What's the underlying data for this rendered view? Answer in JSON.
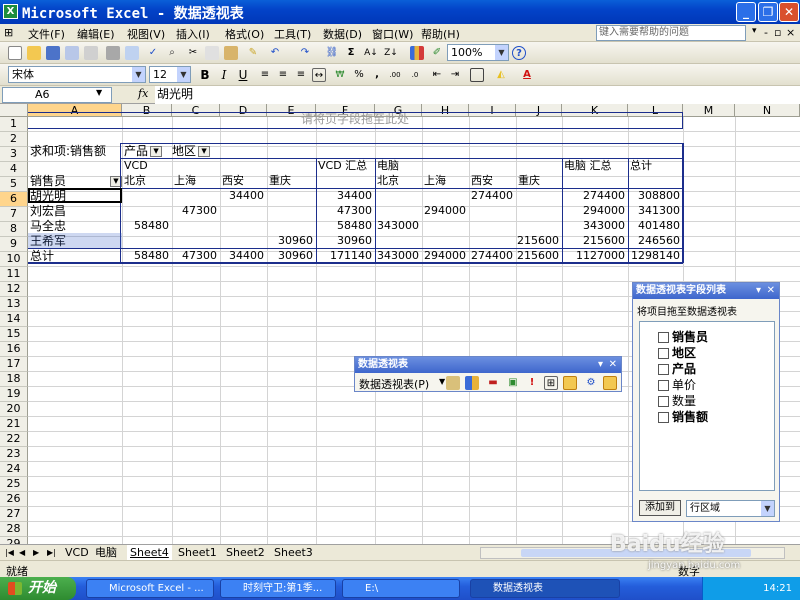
{
  "window": {
    "title": "Microsoft Excel - 数据透视表",
    "app_icon": "X",
    "help_placeholder": "键入需要帮助的问题"
  },
  "menu": [
    "文件(F)",
    "编辑(E)",
    "视图(V)",
    "插入(I)",
    "格式(O)",
    "工具(T)",
    "数据(D)",
    "窗口(W)",
    "帮助(H)"
  ],
  "toolbar": {
    "zoom": "100%",
    "font": "宋体",
    "size": "12",
    "bold": "B",
    "italic": "I",
    "underline": "U"
  },
  "formula": {
    "cell_ref": "A6",
    "fx": "fx",
    "content": "胡光明"
  },
  "columns": [
    "A",
    "B",
    "C",
    "D",
    "E",
    "F",
    "G",
    "H",
    "I",
    "J",
    "K",
    "L",
    "M",
    "N"
  ],
  "rows": [
    "1",
    "2",
    "3",
    "4",
    "5",
    "6",
    "7",
    "8",
    "9",
    "10",
    "11",
    "12",
    "13",
    "14",
    "15",
    "16",
    "17",
    "18",
    "19",
    "20",
    "21",
    "22",
    "23",
    "24",
    "25",
    "26",
    "27",
    "28",
    "29"
  ],
  "pivot": {
    "page_drop": "请将页字段拖至此处",
    "data_label": "求和项:销售额",
    "col_field_1": "产品",
    "col_field_2": "地区",
    "vcd": "VCD",
    "vcd_total": "VCD 汇总",
    "pc": "电脑",
    "pc_total": "电脑 汇总",
    "grand_total": "总计",
    "row_field": "销售员",
    "regions": [
      "北京",
      "上海",
      "西安",
      "重庆",
      "北京",
      "上海",
      "西安",
      "重庆"
    ],
    "rows": [
      {
        "name": "胡光明",
        "cells": [
          "",
          "",
          "34400",
          "",
          "34400",
          "",
          "",
          "274400",
          "",
          "274400",
          "308800"
        ]
      },
      {
        "name": "刘宏昌",
        "cells": [
          "",
          "47300",
          "",
          "",
          "47300",
          "",
          "294000",
          "",
          "",
          "294000",
          "341300"
        ]
      },
      {
        "name": "马全忠",
        "cells": [
          "58480",
          "",
          "",
          "",
          "58480",
          "343000",
          "",
          "",
          "",
          "343000",
          "401480"
        ]
      },
      {
        "name": "王希军",
        "cells": [
          "",
          "",
          "",
          "30960",
          "30960",
          "",
          "",
          "",
          "215600",
          "215600",
          "246560"
        ]
      },
      {
        "name": "总计",
        "cells": [
          "58480",
          "47300",
          "34400",
          "30960",
          "171140",
          "343000",
          "294000",
          "274400",
          "215600",
          "1127000",
          "1298140"
        ]
      }
    ]
  },
  "pivot_toolbar": {
    "title": "数据透视表",
    "menu": "数据透视表(P)"
  },
  "field_list": {
    "title": "数据透视表字段列表",
    "hint": "将项目拖至数据透视表",
    "fields": [
      {
        "label": "销售员",
        "bold": true
      },
      {
        "label": "地区",
        "bold": true
      },
      {
        "label": "产品",
        "bold": true
      },
      {
        "label": "单价",
        "bold": false
      },
      {
        "label": "数量",
        "bold": false
      },
      {
        "label": "销售额",
        "bold": true
      }
    ],
    "add_button": "添加到",
    "area": "行区域"
  },
  "sheets": [
    "VCD",
    "电脑",
    "Sheet4",
    "Sheet1",
    "Sheet2",
    "Sheet3"
  ],
  "active_sheet": "Sheet4",
  "status": {
    "left": "就绪",
    "mode": "数字"
  },
  "taskbar": {
    "start": "开始",
    "items": [
      "Microsoft Excel - ...",
      "时刻守卫:第1季...",
      "E:\\",
      "数据透视表"
    ],
    "clock": "14:21"
  },
  "watermark": {
    "text": "Baidu经验",
    "sub": "jingyan.baidu.com"
  }
}
